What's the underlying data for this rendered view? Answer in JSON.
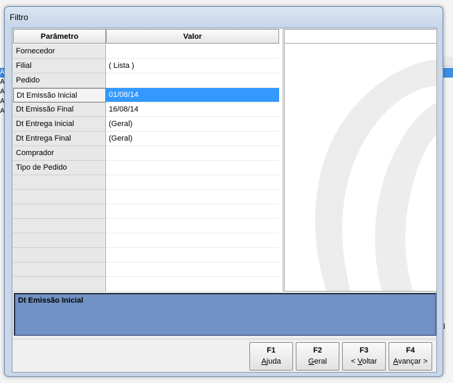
{
  "window": {
    "title": "Filtro"
  },
  "grid": {
    "headers": {
      "param": "Parâmetro",
      "valor": "Valor"
    },
    "rows": [
      {
        "param": "Fornecedor",
        "valor": ""
      },
      {
        "param": "Filial",
        "valor": "( Lista )"
      },
      {
        "param": "Pedido",
        "valor": ""
      },
      {
        "param": "Dt Emissão Inicial",
        "valor": "01/08/14"
      },
      {
        "param": "Dt Emissão Final",
        "valor": "16/08/14"
      },
      {
        "param": "Dt Entrega Inicial",
        "valor": "(Geral)"
      },
      {
        "param": "Dt Entrega Final",
        "valor": "(Geral)"
      },
      {
        "param": "Comprador",
        "valor": ""
      },
      {
        "param": "Tipo de Pedido",
        "valor": ""
      },
      {
        "param": "",
        "valor": ""
      },
      {
        "param": "",
        "valor": ""
      },
      {
        "param": "",
        "valor": ""
      },
      {
        "param": "",
        "valor": ""
      },
      {
        "param": "",
        "valor": ""
      },
      {
        "param": "",
        "valor": ""
      },
      {
        "param": "",
        "valor": ""
      },
      {
        "param": "",
        "valor": ""
      }
    ],
    "selected_index": 3
  },
  "description": {
    "title": "Dt Emissão Inicial"
  },
  "buttons": [
    {
      "key": "F1",
      "label": "Ajuda",
      "mnemonic": "A"
    },
    {
      "key": "F2",
      "label": "Geral",
      "mnemonic": "G"
    },
    {
      "key": "F3",
      "label": "< Voltar",
      "mnemonic": "V"
    },
    {
      "key": "F4",
      "label": "Avançar >",
      "mnemonic": "A"
    }
  ],
  "background": {
    "left_rows": [
      "A",
      "A",
      "A",
      "A",
      "A"
    ],
    "right_text": "al"
  },
  "colors": {
    "selection": "#3399ff",
    "description_bg": "#7192c4",
    "dialog_frame": "#c9d7e8"
  }
}
